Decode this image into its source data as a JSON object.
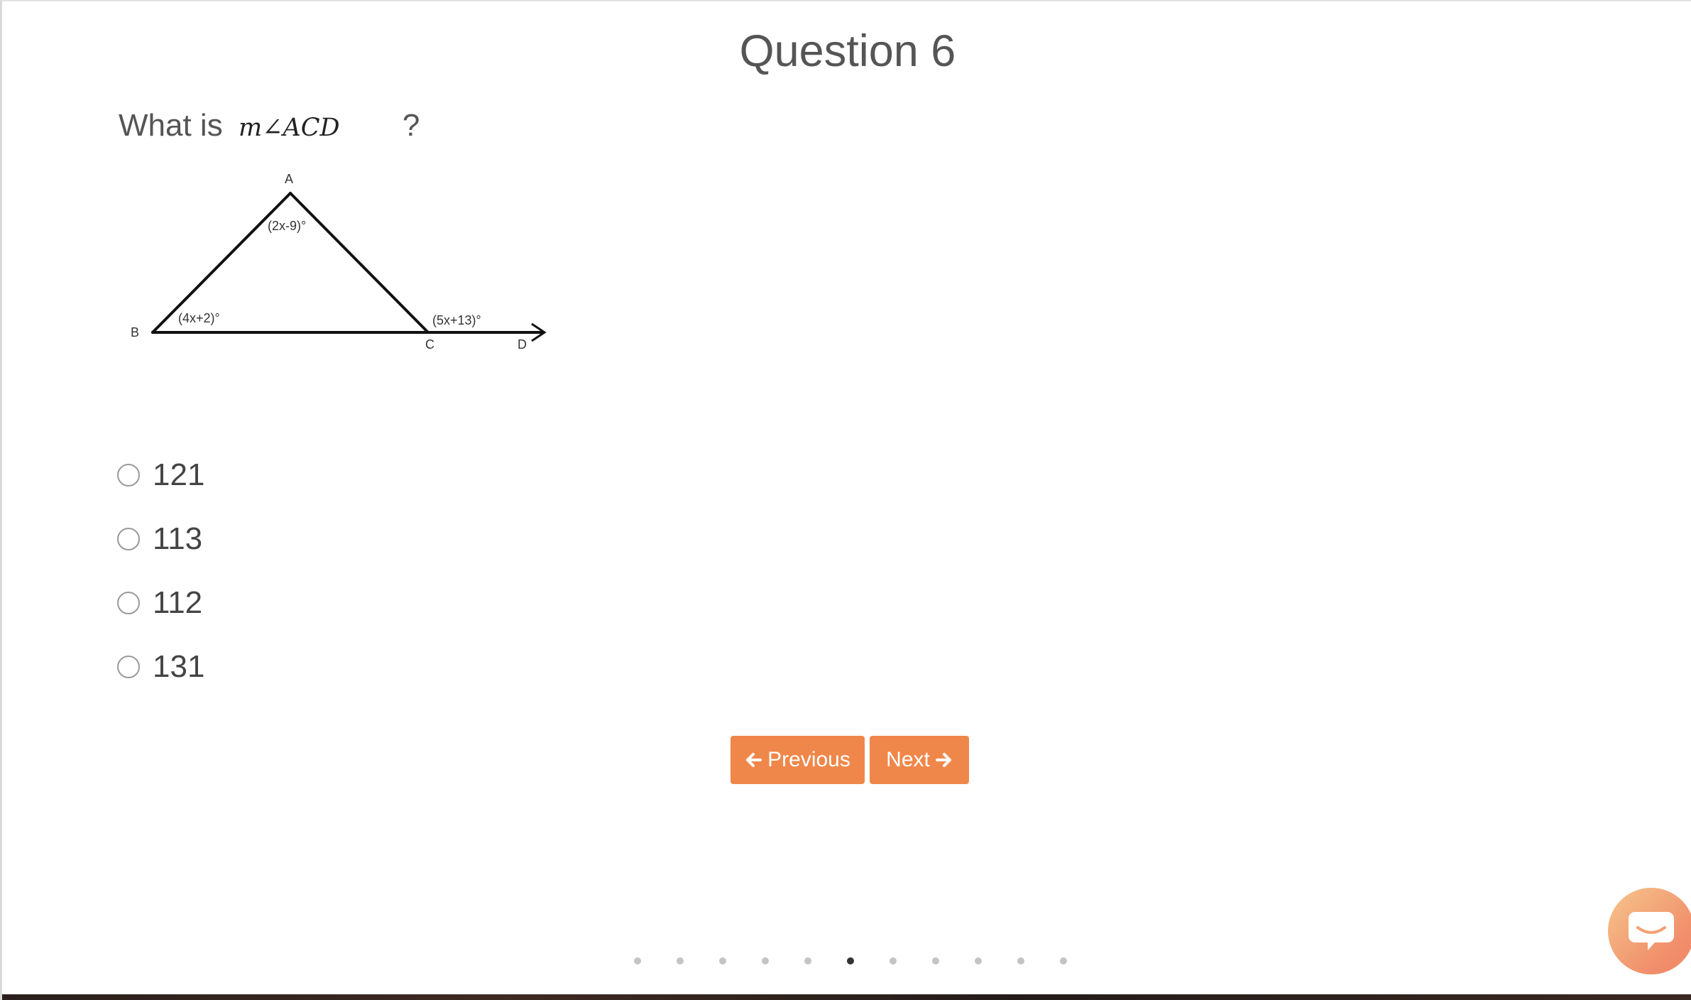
{
  "header": {
    "title": "Question 6"
  },
  "question": {
    "prefix": "What is",
    "math": "m∠ACD",
    "suffix": "?"
  },
  "figure": {
    "vertex_labels": [
      "A",
      "B",
      "C",
      "D"
    ],
    "angle_labels": [
      "(2x-9)°",
      "(4x+2)°",
      "(5x+13)°"
    ]
  },
  "choices": [
    {
      "label": "121"
    },
    {
      "label": "113"
    },
    {
      "label": "112"
    },
    {
      "label": "131"
    }
  ],
  "navigation": {
    "previous_label": "Previous",
    "next_label": "Next"
  },
  "pagination": {
    "total": 11,
    "current": 6
  },
  "colors": {
    "accent": "#f0874a",
    "text": "#555555"
  },
  "chat": {
    "icon": "chat-bubble-icon"
  }
}
